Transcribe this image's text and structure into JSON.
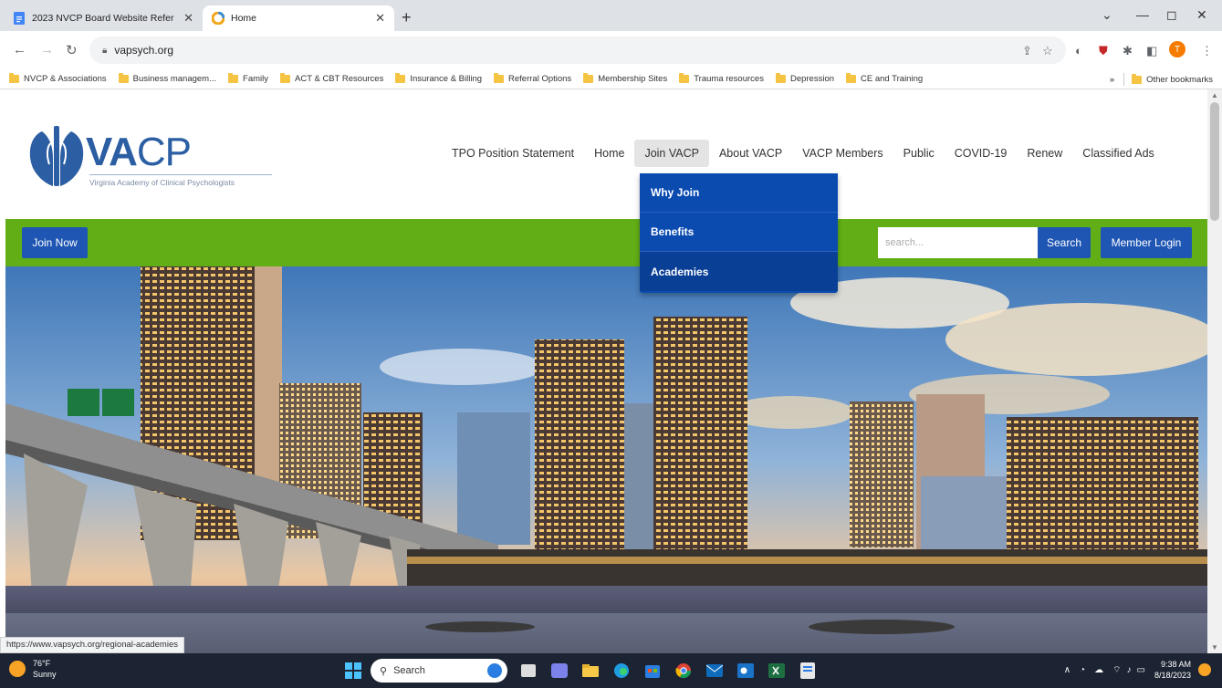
{
  "browser": {
    "tabs": [
      {
        "title": "2023 NVCP Board Website Refer",
        "active": false
      },
      {
        "title": "Home",
        "active": true
      }
    ],
    "url": "vapsych.org",
    "new_tab": "+",
    "bookmarks": [
      "NVCP & Associations",
      "Business managem...",
      "Family",
      "ACT & CBT Resources",
      "Insurance & Billing",
      "Referral Options",
      "Membership Sites",
      "Trauma resources",
      "Depression",
      "CE and Training"
    ],
    "bookmarks_overflow": "»",
    "other_bookmarks": "Other bookmarks",
    "profile_initial": "T",
    "status_url": "https://www.vapsych.org/regional-academies"
  },
  "site": {
    "logo_text_bold": "VA",
    "logo_text_light": "CP",
    "logo_tagline": "Virginia Academy of Clinical Psychologists",
    "nav": [
      "TPO Position Statement",
      "Home",
      "Join VACP",
      "About VACP",
      "VACP Members",
      "Public",
      "COVID-19",
      "Renew",
      "Classified Ads"
    ],
    "dropdown": [
      "Why Join",
      "Benefits",
      "Academies"
    ],
    "join_now": "Join Now",
    "search_placeholder": "search...",
    "search_button": "Search",
    "member_login": "Member Login"
  },
  "taskbar": {
    "temperature": "76°F",
    "weather": "Sunny",
    "search_label": "Search",
    "time": "9:38 AM",
    "date": "8/18/2023"
  },
  "colors": {
    "green_bar": "#62ae16",
    "button_blue": "#1f56b3",
    "dropdown_blue": "#0b4bb0",
    "logo_blue": "#2b5ea3"
  }
}
